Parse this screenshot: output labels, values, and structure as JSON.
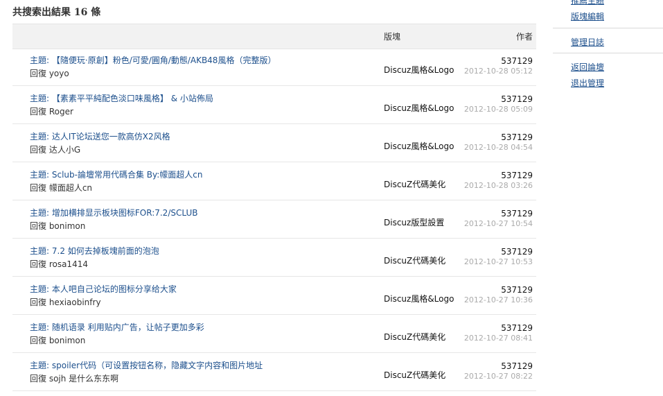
{
  "header": {
    "result_title": "共搜索出結果 16 條"
  },
  "table": {
    "col_forum": "版塊",
    "col_author": "作者"
  },
  "rows": [
    {
      "topic_prefix": "主題:",
      "topic": "【隨便玩·原創】粉色/可愛/圓角/動態/AKB48風格（完整版）",
      "reply": "回復 yoyo",
      "forum": "Discuz風格&Logo",
      "author": "537129",
      "date": "2012-10-28 05:12"
    },
    {
      "topic_prefix": "主題:",
      "topic": "【素素平平純配色淡口味風格】 & 小站佈局",
      "reply": "回復 Roger",
      "forum": "Discuz風格&Logo",
      "author": "537129",
      "date": "2012-10-28 05:09"
    },
    {
      "topic_prefix": "主題:",
      "topic": "达人IT论坛送您一款高仿X2风格",
      "reply": "回復 达人小G",
      "forum": "Discuz風格&Logo",
      "author": "537129",
      "date": "2012-10-28 04:54"
    },
    {
      "topic_prefix": "主題:",
      "topic": "Sclub-論壇常用代碼合集 By:幪面超人cn",
      "reply": "回復 幪面超人cn",
      "forum": "DiscuZ代碼美化",
      "author": "537129",
      "date": "2012-10-28 03:26"
    },
    {
      "topic_prefix": "主題:",
      "topic": "增加横排显示板块图标FOR:7.2/SCLUB",
      "reply": "回復 bonimon",
      "forum": "Discuz版型設置",
      "author": "537129",
      "date": "2012-10-27 10:54"
    },
    {
      "topic_prefix": "主題:",
      "topic": "7.2 如何去掉板塊前面的泡泡",
      "reply": "回復 rosa1414",
      "forum": "DiscuZ代碼美化",
      "author": "537129",
      "date": "2012-10-27 10:53"
    },
    {
      "topic_prefix": "主題:",
      "topic": "本人吧自己论坛的图标分享给大家",
      "reply": "回復 hexiaobinfry",
      "forum": "Discuz風格&Logo",
      "author": "537129",
      "date": "2012-10-27 10:36"
    },
    {
      "topic_prefix": "主題:",
      "topic": "随机语录 利用贴内广告，让帖子更加多彩",
      "reply": "回復 bonimon",
      "forum": "DiscuZ代碼美化",
      "author": "537129",
      "date": "2012-10-27 08:41"
    },
    {
      "topic_prefix": "主題:",
      "topic": "spoiler代码（可设置按钮名称，隐藏文字内容和图片地址",
      "reply": "回復 sojh 是什么东东啊",
      "forum": "DiscuZ代碼美化",
      "author": "537129",
      "date": "2012-10-27 08:22"
    }
  ],
  "sidebar": {
    "links": [
      "推薦主題",
      "版塊編輯",
      "管理日誌",
      "返回論壇",
      "退出管理"
    ]
  }
}
